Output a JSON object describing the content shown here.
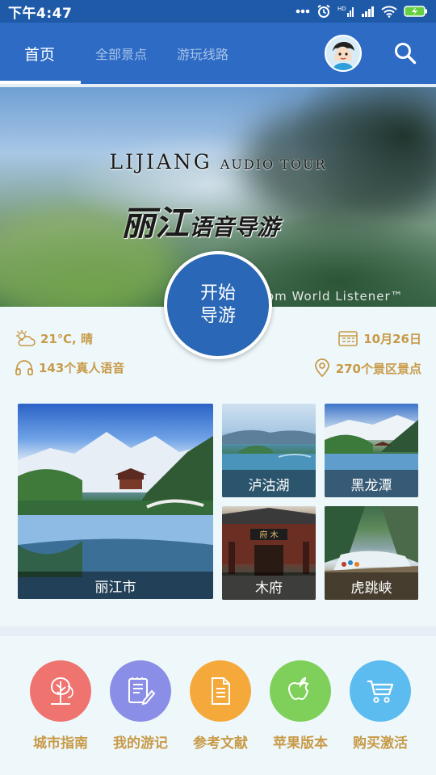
{
  "status_bar": {
    "time": "下午4:47"
  },
  "app_bar": {
    "tabs": [
      {
        "label": "首页",
        "active": true
      },
      {
        "label": "全部景点",
        "active": false
      },
      {
        "label": "游玩线路",
        "active": false
      }
    ]
  },
  "hero": {
    "title_en_main": "LIJIANG",
    "title_en_sub": "AUDIO TOUR",
    "title_cn_main": "丽江",
    "title_cn_rest": "语音导游",
    "watermark": "om World Listener™"
  },
  "start_button": {
    "line1": "开始",
    "line2": "导游"
  },
  "info": {
    "weather": "21℃, 晴",
    "date": "10月26日",
    "audio_count": "143个真人语音",
    "spot_count": "270个景区景点"
  },
  "tiles": [
    {
      "label": "丽江市"
    },
    {
      "label": "泸沽湖"
    },
    {
      "label": "黑龙潭"
    },
    {
      "label": "木府"
    },
    {
      "label": "虎跳峡"
    }
  ],
  "bottom_nav": [
    {
      "label": "城市指南",
      "icon": "tree-icon",
      "color": "#ef7470"
    },
    {
      "label": "我的游记",
      "icon": "notes-icon",
      "color": "#8b8ee6"
    },
    {
      "label": "参考文献",
      "icon": "document-icon",
      "color": "#f5a93a"
    },
    {
      "label": "苹果版本",
      "icon": "apple-icon",
      "color": "#7fd05a"
    },
    {
      "label": "购买激活",
      "icon": "cart-icon",
      "color": "#5cbcf0"
    }
  ],
  "colors": {
    "primary": "#2d6bc4",
    "accent_text": "#c89a48",
    "background": "#eef8fb"
  }
}
